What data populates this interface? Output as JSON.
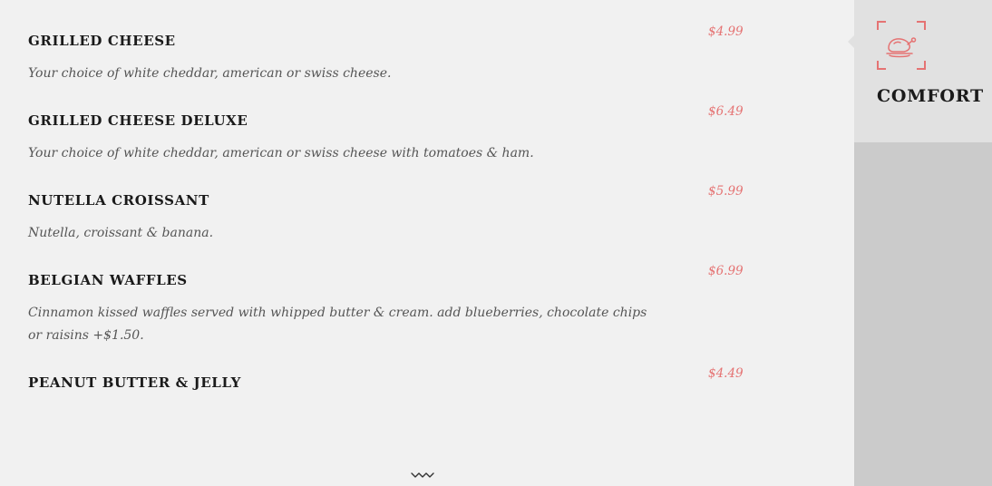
{
  "menu": {
    "items": [
      {
        "name": "GRILLED CHEESE",
        "price": "$4.99",
        "description": "Your choice of white cheddar, american or swiss cheese."
      },
      {
        "name": "GRILLED CHEESE DELUXE",
        "price": "$6.49",
        "description": "Your choice of white cheddar, american or swiss cheese with tomatoes & ham."
      },
      {
        "name": "NUTELLA CROISSANT",
        "price": "$5.99",
        "description": "Nutella, croissant & banana."
      },
      {
        "name": "BELGIAN WAFFLES",
        "price": "$6.99",
        "description": "Cinnamon kissed waffles served with whipped butter & cream. add blueberries, chocolate chips or raisins +$1.50."
      },
      {
        "name": "PEANUT BUTTER & JELLY",
        "price": "$4.49",
        "description": ""
      }
    ]
  },
  "sidebar": {
    "active_category": {
      "label": "COMFORT",
      "icon": "roast-chicken-icon"
    }
  },
  "scroll_indicator": {
    "icon": "wavy-chevron-down-icon"
  },
  "colors": {
    "accent": "#e57373",
    "background": "#f1f1f1",
    "sidebar": "#cbcbcb",
    "active_tab": "#e1e1e1"
  }
}
